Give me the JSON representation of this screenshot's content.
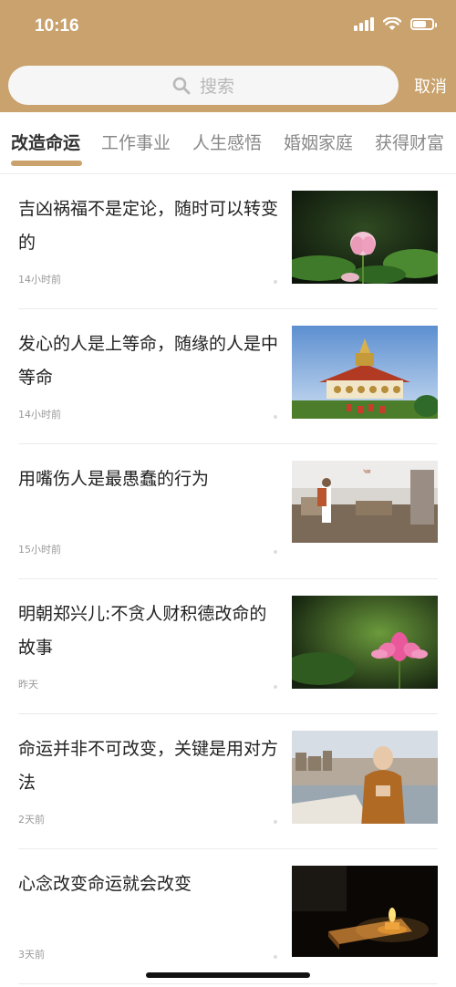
{
  "status_bar": {
    "time": "10:16"
  },
  "search": {
    "placeholder": "搜索",
    "cancel_label": "取消"
  },
  "tabs": [
    {
      "label": "改造命运",
      "active": true
    },
    {
      "label": "工作事业",
      "active": false
    },
    {
      "label": "人生感悟",
      "active": false
    },
    {
      "label": "婚姻家庭",
      "active": false
    },
    {
      "label": "获得财富",
      "active": false
    }
  ],
  "articles": [
    {
      "title": "吉凶祸福不是定论，随时可以转变的",
      "time": "14小时前",
      "image": "lotus-bud-thumbnail"
    },
    {
      "title": "发心的人是上等命，随缘的人是中等命",
      "time": "14小时前",
      "image": "temple-thumbnail"
    },
    {
      "title": "用嘴伤人是最愚蠢的行为",
      "time": "15小时前",
      "image": "monk-street-thumbnail"
    },
    {
      "title": "明朝郑兴儿:不贪人财积德改命的故事",
      "time": "昨天",
      "image": "pink-lotus-thumbnail"
    },
    {
      "title": "命运并非不可改变，关键是用对方法",
      "time": "2天前",
      "image": "elder-monk-thumbnail"
    },
    {
      "title": "心念改变命运就会改变",
      "time": "3天前",
      "image": "candle-scripture-thumbnail"
    }
  ],
  "colors": {
    "header": "#c9a26d",
    "accent": "#c9a26d"
  }
}
